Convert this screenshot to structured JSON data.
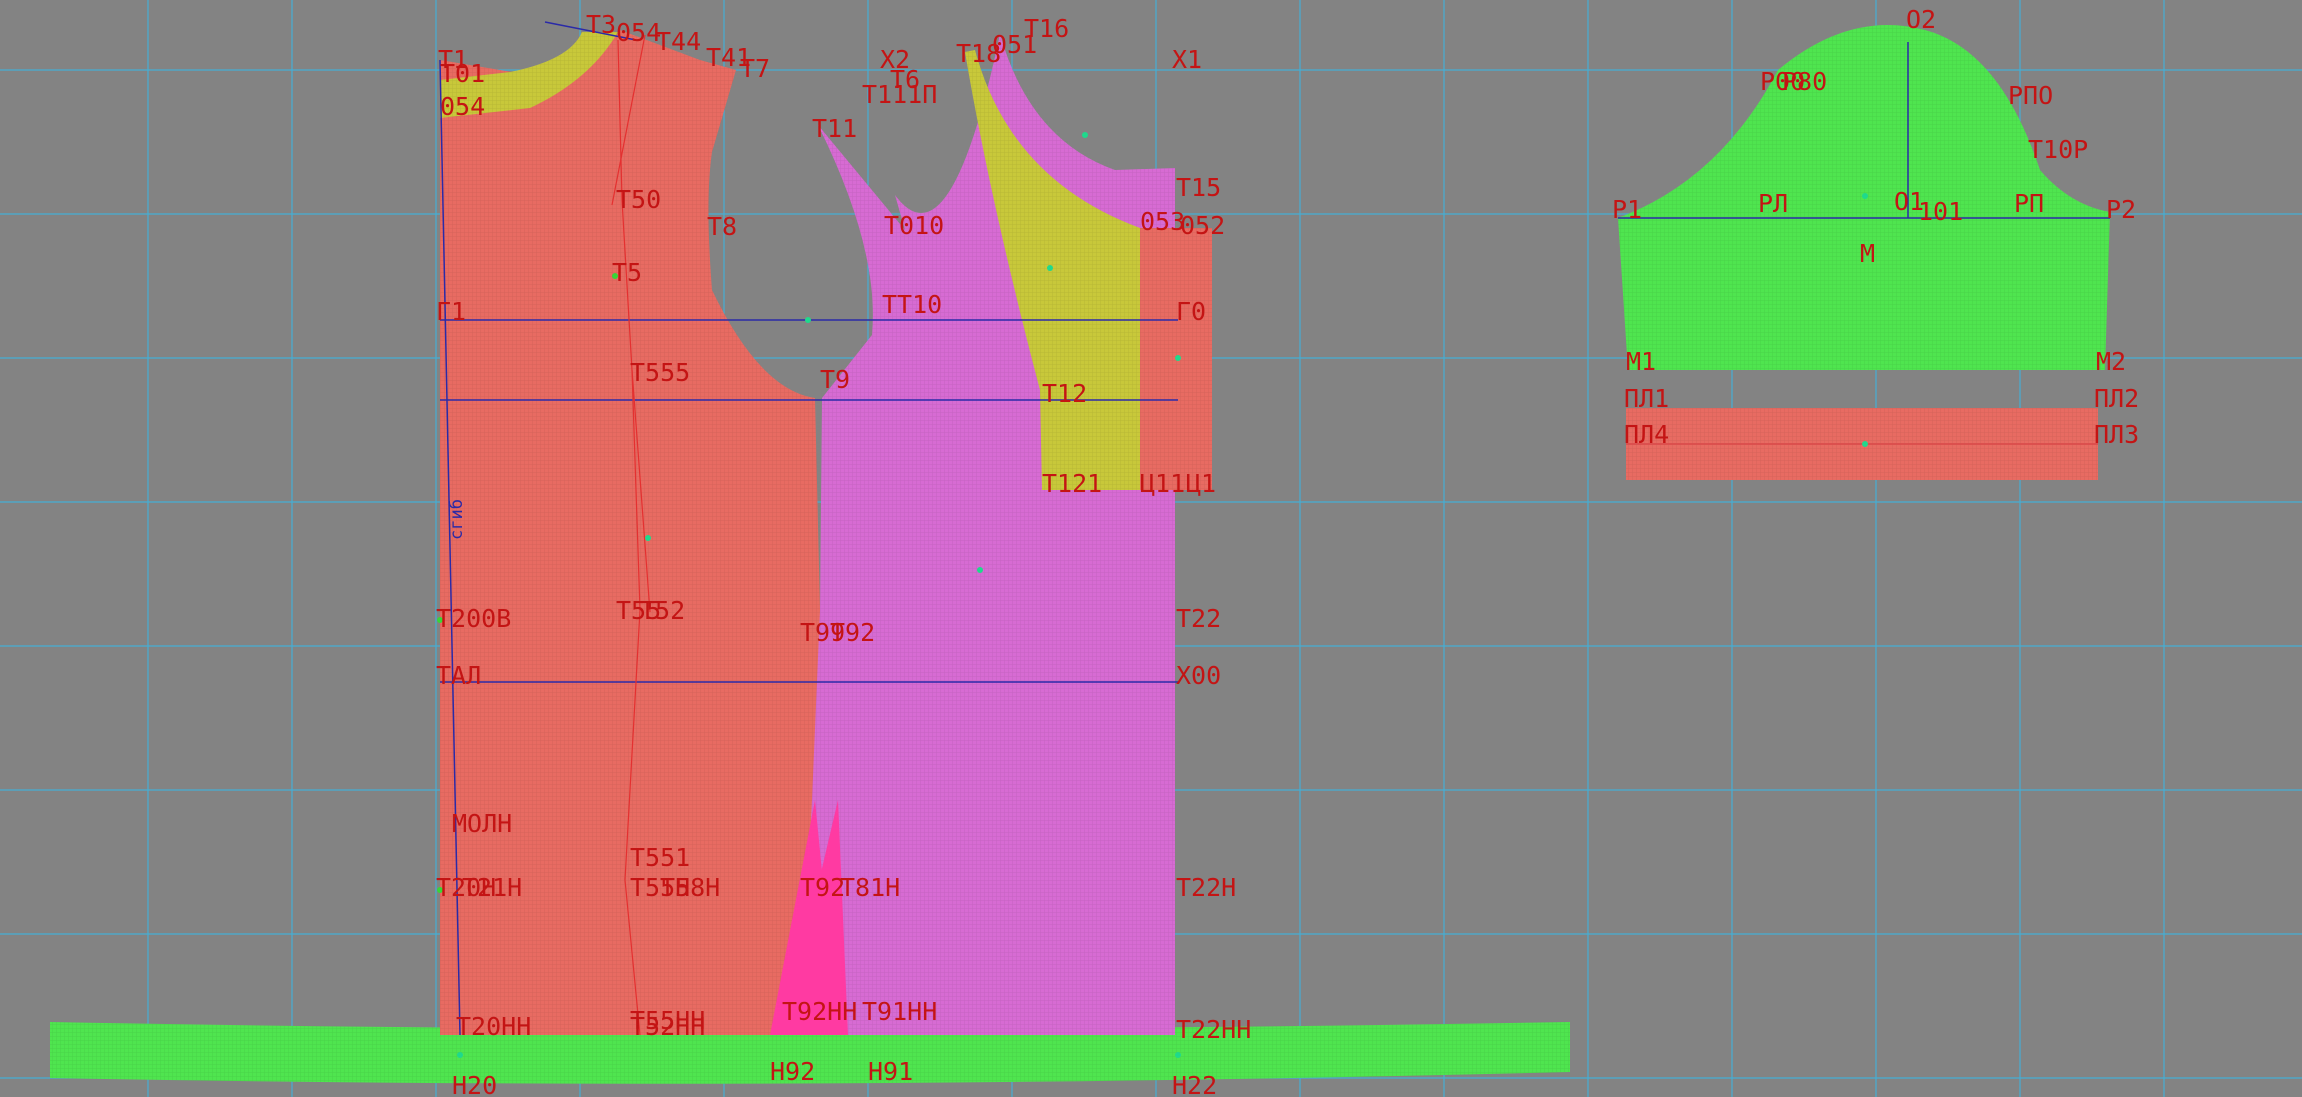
{
  "colors": {
    "background": "#838383",
    "grid": "#3fb3dd",
    "front_piece": "#e86b62",
    "back_piece": "#d76bd3",
    "facing": "#c8c83a",
    "hem_band": "#4fe54f",
    "sleeve": "#4fe54f",
    "cuff": "#e86b62",
    "label": "#c41414",
    "construction_line": "#2a2aa8"
  },
  "labels": {
    "T3": "Т3",
    "T054": "054",
    "T44": "Т44",
    "T41": "Т41",
    "X2": "Х2",
    "T6": "Т6",
    "T16": "Т16",
    "X1": "Х1",
    "T1": "Т1",
    "T01": "Т01",
    "o54": "054",
    "T7": "Т7",
    "T111": "Т111П",
    "T11": "Т11",
    "T18": "Т18",
    "T051": "051",
    "T50": "Т50",
    "T8": "Т8",
    "T010": "Т010",
    "T15": "Т15",
    "T053": "053",
    "T052": "052",
    "T5": "Т5",
    "G1": "Г1",
    "TT10": "ТТ10",
    "G0": "Г0",
    "T555": "Т555",
    "T9": "Т9",
    "T12": "Т12",
    "T121": "Т121",
    "C11": "Ц11",
    "C1": "Ц1",
    "fold": "сгиб",
    "T200": "Т200В",
    "T55": "Т55",
    "T52": "Т52",
    "T99": "Т99",
    "T92": "Т92",
    "T22": "Т22",
    "TAL": "ТАЛ",
    "X00": "Х00",
    "MOLN": "МОЛН",
    "T551": "Т551",
    "T20H": "Т20Н",
    "T21H": "Т21Н",
    "T55H": "Т55Н",
    "T58H": "Т58Н",
    "T92b": "Т92",
    "T81H": "Т81Н",
    "T22H": "Т22Н",
    "T20HH": "Т20НН",
    "T52HH": "Т52НН",
    "T55HH": "Т55НН",
    "T92HH": "Т92НН",
    "T91HH": "Т91НН",
    "T22HH": "Т22НН",
    "H20": "Н20",
    "H92": "Н92",
    "H91": "Н91",
    "H22": "Н22",
    "O2": "О2",
    "P00": "Р00",
    "P80": "Р80",
    "RPO": "РПО",
    "T10P": "Т10Р",
    "P1": "Р1",
    "RL": "РЛ",
    "O1": "О1",
    "O101": "101",
    "RP": "РП",
    "P2": "Р2",
    "M": "М",
    "M1": "М1",
    "M2": "М2",
    "PL1": "ПЛ1",
    "PL2": "ПЛ2",
    "PL4": "ПЛ4",
    "PL3": "ПЛ3"
  }
}
